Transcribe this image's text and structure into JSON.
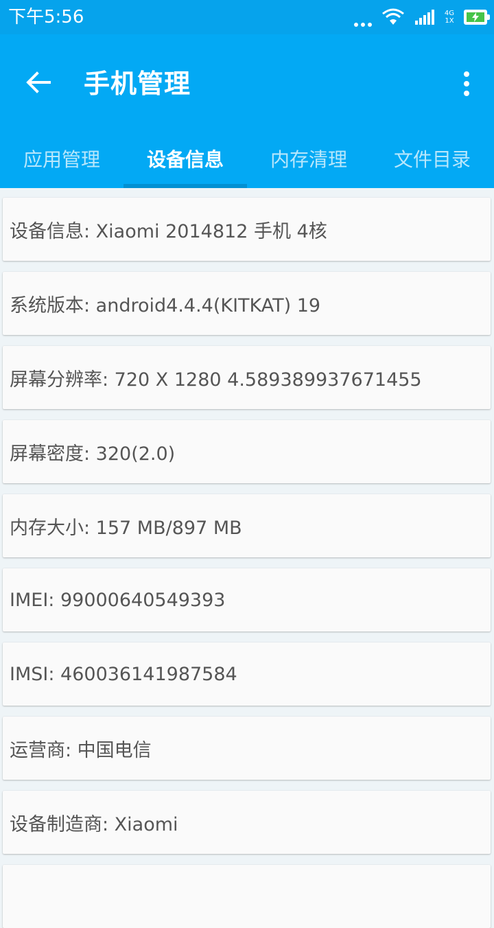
{
  "status_bar": {
    "time": "下午5:56",
    "net_top": "4G",
    "net_bottom": "1X",
    "icons": [
      "dots-icon",
      "wifi-icon",
      "signal-icon",
      "battery-charging-icon"
    ],
    "battery_color": "#47c44a"
  },
  "app_bar": {
    "title": "手机管理",
    "back_icon": "arrow-left-icon",
    "more_icon": "more-vertical-icon",
    "background": "#03a9f4"
  },
  "tabs": [
    {
      "label": "应用管理",
      "active": false
    },
    {
      "label": "设备信息",
      "active": true
    },
    {
      "label": "内存清理",
      "active": false
    },
    {
      "label": "文件目录",
      "active": false
    }
  ],
  "device_info": [
    {
      "text": "设备信息:  Xiaomi 2014812 手机 4核"
    },
    {
      "text": "系统版本:  android4.4.4(KITKAT) 19"
    },
    {
      "text": "屏幕分辨率:  720 X 1280 4.589389937671455"
    },
    {
      "text": "屏幕密度:  320(2.0)"
    },
    {
      "text": "内存大小:  157 MB/897 MB"
    },
    {
      "text": "IMEI:  99000640549393"
    },
    {
      "text": "IMSI:  460036141987584"
    },
    {
      "text": "运营商:  中国电信"
    },
    {
      "text": "设备制造商:  Xiaomi"
    },
    {
      "text": ""
    }
  ]
}
